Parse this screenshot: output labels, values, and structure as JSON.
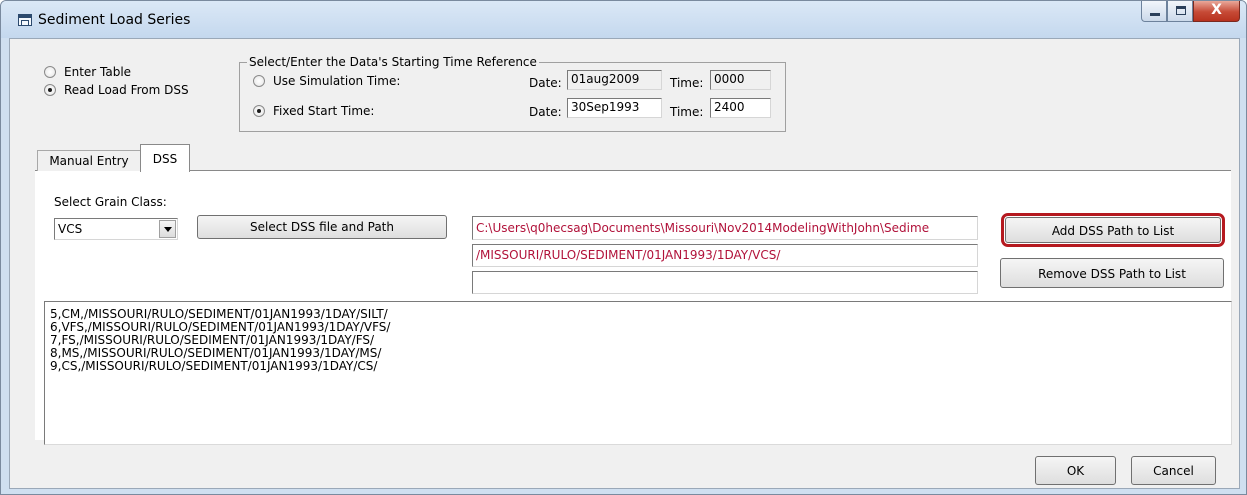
{
  "window": {
    "title": "Sediment Load Series",
    "controls": {
      "minimize": "",
      "maximize": "",
      "close": "X"
    }
  },
  "input_mode": {
    "options": [
      {
        "label": "Enter Table",
        "selected": false
      },
      {
        "label": "Read Load From DSS",
        "selected": true
      }
    ]
  },
  "time_reference": {
    "legend": "Select/Enter the Data's Starting Time Reference",
    "options": [
      {
        "label": "Use Simulation Time:",
        "selected": false,
        "date_label": "Date:",
        "date": "01aug2009",
        "time_label": "Time:",
        "time": "0000"
      },
      {
        "label": "Fixed Start Time:",
        "selected": true,
        "date_label": "Date:",
        "date": "30Sep1993",
        "time_label": "Time:",
        "time": "2400"
      }
    ]
  },
  "tabs": [
    {
      "label": "Manual Entry",
      "active": false
    },
    {
      "label": "DSS",
      "active": true
    }
  ],
  "dss": {
    "grain_class_label": "Select Grain Class:",
    "grain_class_value": "VCS",
    "select_file_button": "Select DSS file and Path",
    "file_path": "C:\\Users\\q0hecsag\\Documents\\Missouri\\Nov2014ModelingWithJohn\\Sedime",
    "dss_path": "/MISSOURI/RULO/SEDIMENT/01JAN1993/1DAY/VCS/",
    "extra_path": "",
    "add_button": "Add DSS Path to List",
    "remove_button": "Remove DSS Path to List",
    "path_color": "#b1123a",
    "highlight_color": "#b5191f"
  },
  "path_list": [
    "5,CM,/MISSOURI/RULO/SEDIMENT/01JAN1993/1DAY/SILT/",
    "6,VFS,/MISSOURI/RULO/SEDIMENT/01JAN1993/1DAY/VFS/",
    "7,FS,/MISSOURI/RULO/SEDIMENT/01JAN1993/1DAY/FS/",
    "8,MS,/MISSOURI/RULO/SEDIMENT/01JAN1993/1DAY/MS/",
    "9,CS,/MISSOURI/RULO/SEDIMENT/01JAN1993/1DAY/CS/"
  ],
  "footer": {
    "ok": "OK",
    "cancel": "Cancel"
  }
}
